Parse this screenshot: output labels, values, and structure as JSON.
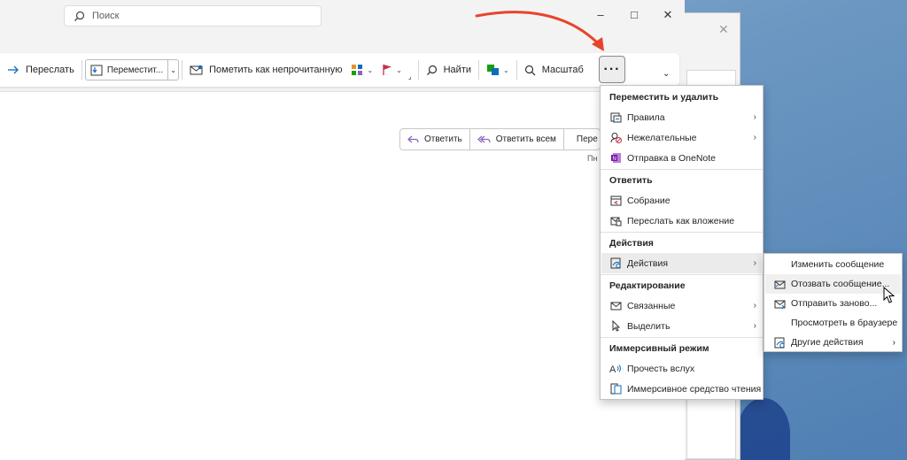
{
  "search": {
    "placeholder": "Поиск"
  },
  "window_controls": {
    "minimize": "–",
    "maximize": "□",
    "close": "✕"
  },
  "ribbon": {
    "forward": "Переслать",
    "move": "Переместит...",
    "mark_unread": "Пометить как непрочитанную",
    "find": "Найти",
    "zoom": "Масштаб",
    "more": "···"
  },
  "reply_bar": {
    "reply": "Ответить",
    "reply_all": "Ответить всем",
    "forward_partial": "Пере",
    "date_partial": "Пн"
  },
  "menu": {
    "sections": [
      {
        "heading": "Переместить и удалить",
        "items": [
          {
            "label": "Правила",
            "icon": "rules-icon",
            "submenu": true
          },
          {
            "label": "Нежелательные",
            "icon": "junk-icon",
            "submenu": true
          },
          {
            "label": "Отправка в OneNote",
            "icon": "onenote-icon",
            "submenu": false
          }
        ]
      },
      {
        "heading": "Ответить",
        "items": [
          {
            "label": "Собрание",
            "icon": "calendar-icon",
            "submenu": false
          },
          {
            "label": "Переслать как вложение",
            "icon": "forward-attachment-icon",
            "submenu": false
          }
        ]
      },
      {
        "heading": "Действия",
        "items": [
          {
            "label": "Действия",
            "icon": "actions-icon",
            "submenu": true,
            "active": true
          }
        ]
      },
      {
        "heading": "Редактирование",
        "items": [
          {
            "label": "Связанные",
            "icon": "related-mail-icon",
            "submenu": true
          },
          {
            "label": "Выделить",
            "icon": "select-cursor-icon",
            "submenu": true
          }
        ]
      },
      {
        "heading": "Иммерсивный режим",
        "items": [
          {
            "label": "Прочесть вслух",
            "icon": "read-aloud-icon",
            "submenu": false
          },
          {
            "label": "Иммерсивное средство чтения",
            "icon": "immersive-reader-icon",
            "submenu": false
          }
        ]
      }
    ]
  },
  "submenu": {
    "items": [
      {
        "label": "Изменить сообщение",
        "icon": "",
        "submenu": false
      },
      {
        "label": "Отозвать сообщение...",
        "icon": "recall-mail-icon",
        "submenu": false,
        "hover": true
      },
      {
        "label": "Отправить заново...",
        "icon": "resend-mail-icon",
        "submenu": false
      },
      {
        "label": "Просмотреть в браузере",
        "icon": "",
        "submenu": false
      },
      {
        "label": "Другие действия",
        "icon": "other-actions-icon",
        "submenu": true
      }
    ]
  },
  "colors": {
    "accent_arrow": "#e8432b",
    "flag": "#c4314b",
    "onenote": "#7719aa",
    "link_blue": "#0f6cbd"
  }
}
